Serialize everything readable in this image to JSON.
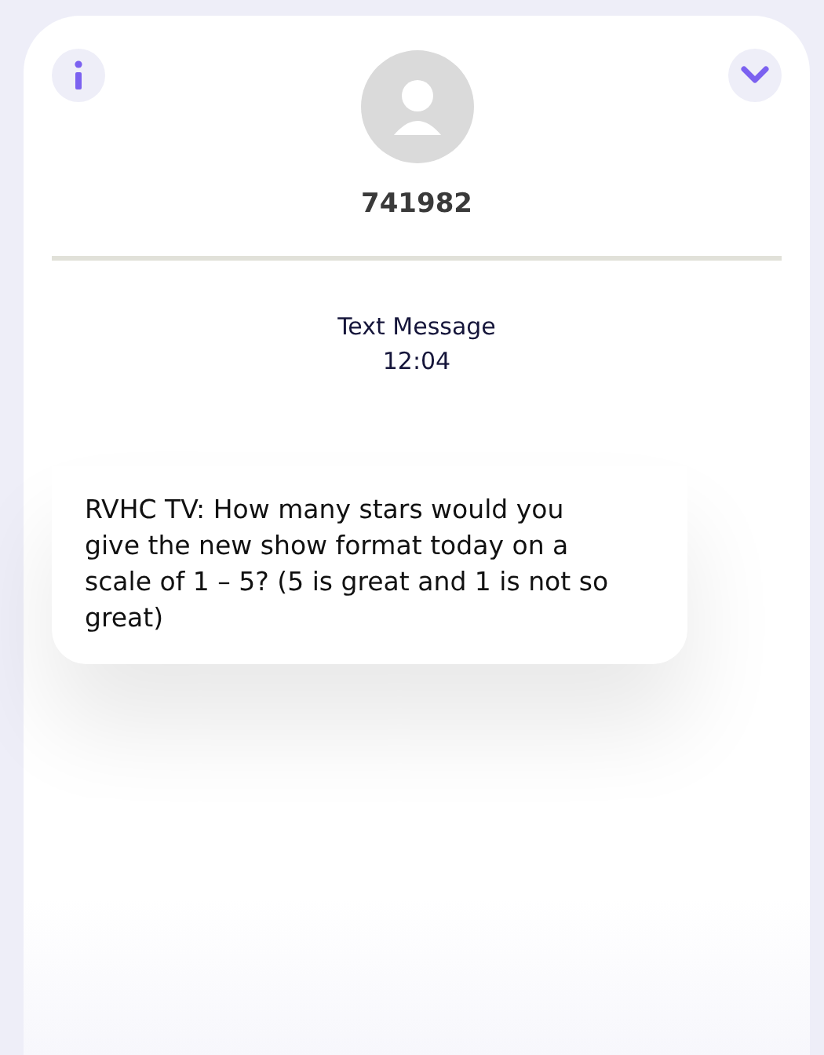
{
  "header": {
    "contact": "741982"
  },
  "conversation": {
    "label": "Text Message",
    "time": "12:04"
  },
  "messages": [
    {
      "text": "RVHC TV: How many stars would you give the new show format today on a scale of 1 – 5? (5 is great and 1 is not so great)"
    }
  ]
}
